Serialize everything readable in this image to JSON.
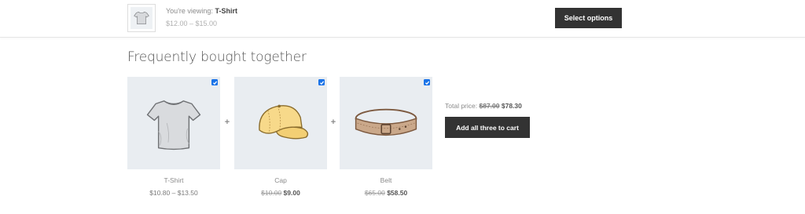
{
  "sticky_bar": {
    "viewing_prefix": "You're viewing:",
    "product_name": "T-Shirt",
    "price_range": "$12.00 – $15.00",
    "select_button": "Select options",
    "thumbnail_icon": "tshirt-icon"
  },
  "bundle": {
    "title": "Frequently bought together",
    "plus_sign": "+",
    "items": [
      {
        "name": "T-Shirt",
        "price": "$10.80 – $13.50",
        "original_price": "",
        "sale_price": "",
        "checked": true,
        "icon": "tshirt-icon"
      },
      {
        "name": "Cap",
        "price": "",
        "original_price": "$10.00",
        "sale_price": "$9.00",
        "checked": true,
        "icon": "cap-icon"
      },
      {
        "name": "Belt",
        "price": "",
        "original_price": "$65.00",
        "sale_price": "$58.50",
        "checked": true,
        "icon": "belt-icon"
      }
    ],
    "total_label": "Total price:",
    "total_original": "$87.00",
    "total_sale": "$78.30",
    "add_button": "Add all three to cart"
  },
  "colors": {
    "button_bg": "#333333",
    "tile_bg": "#e9edf1",
    "checkbox": "#1a73e8"
  }
}
